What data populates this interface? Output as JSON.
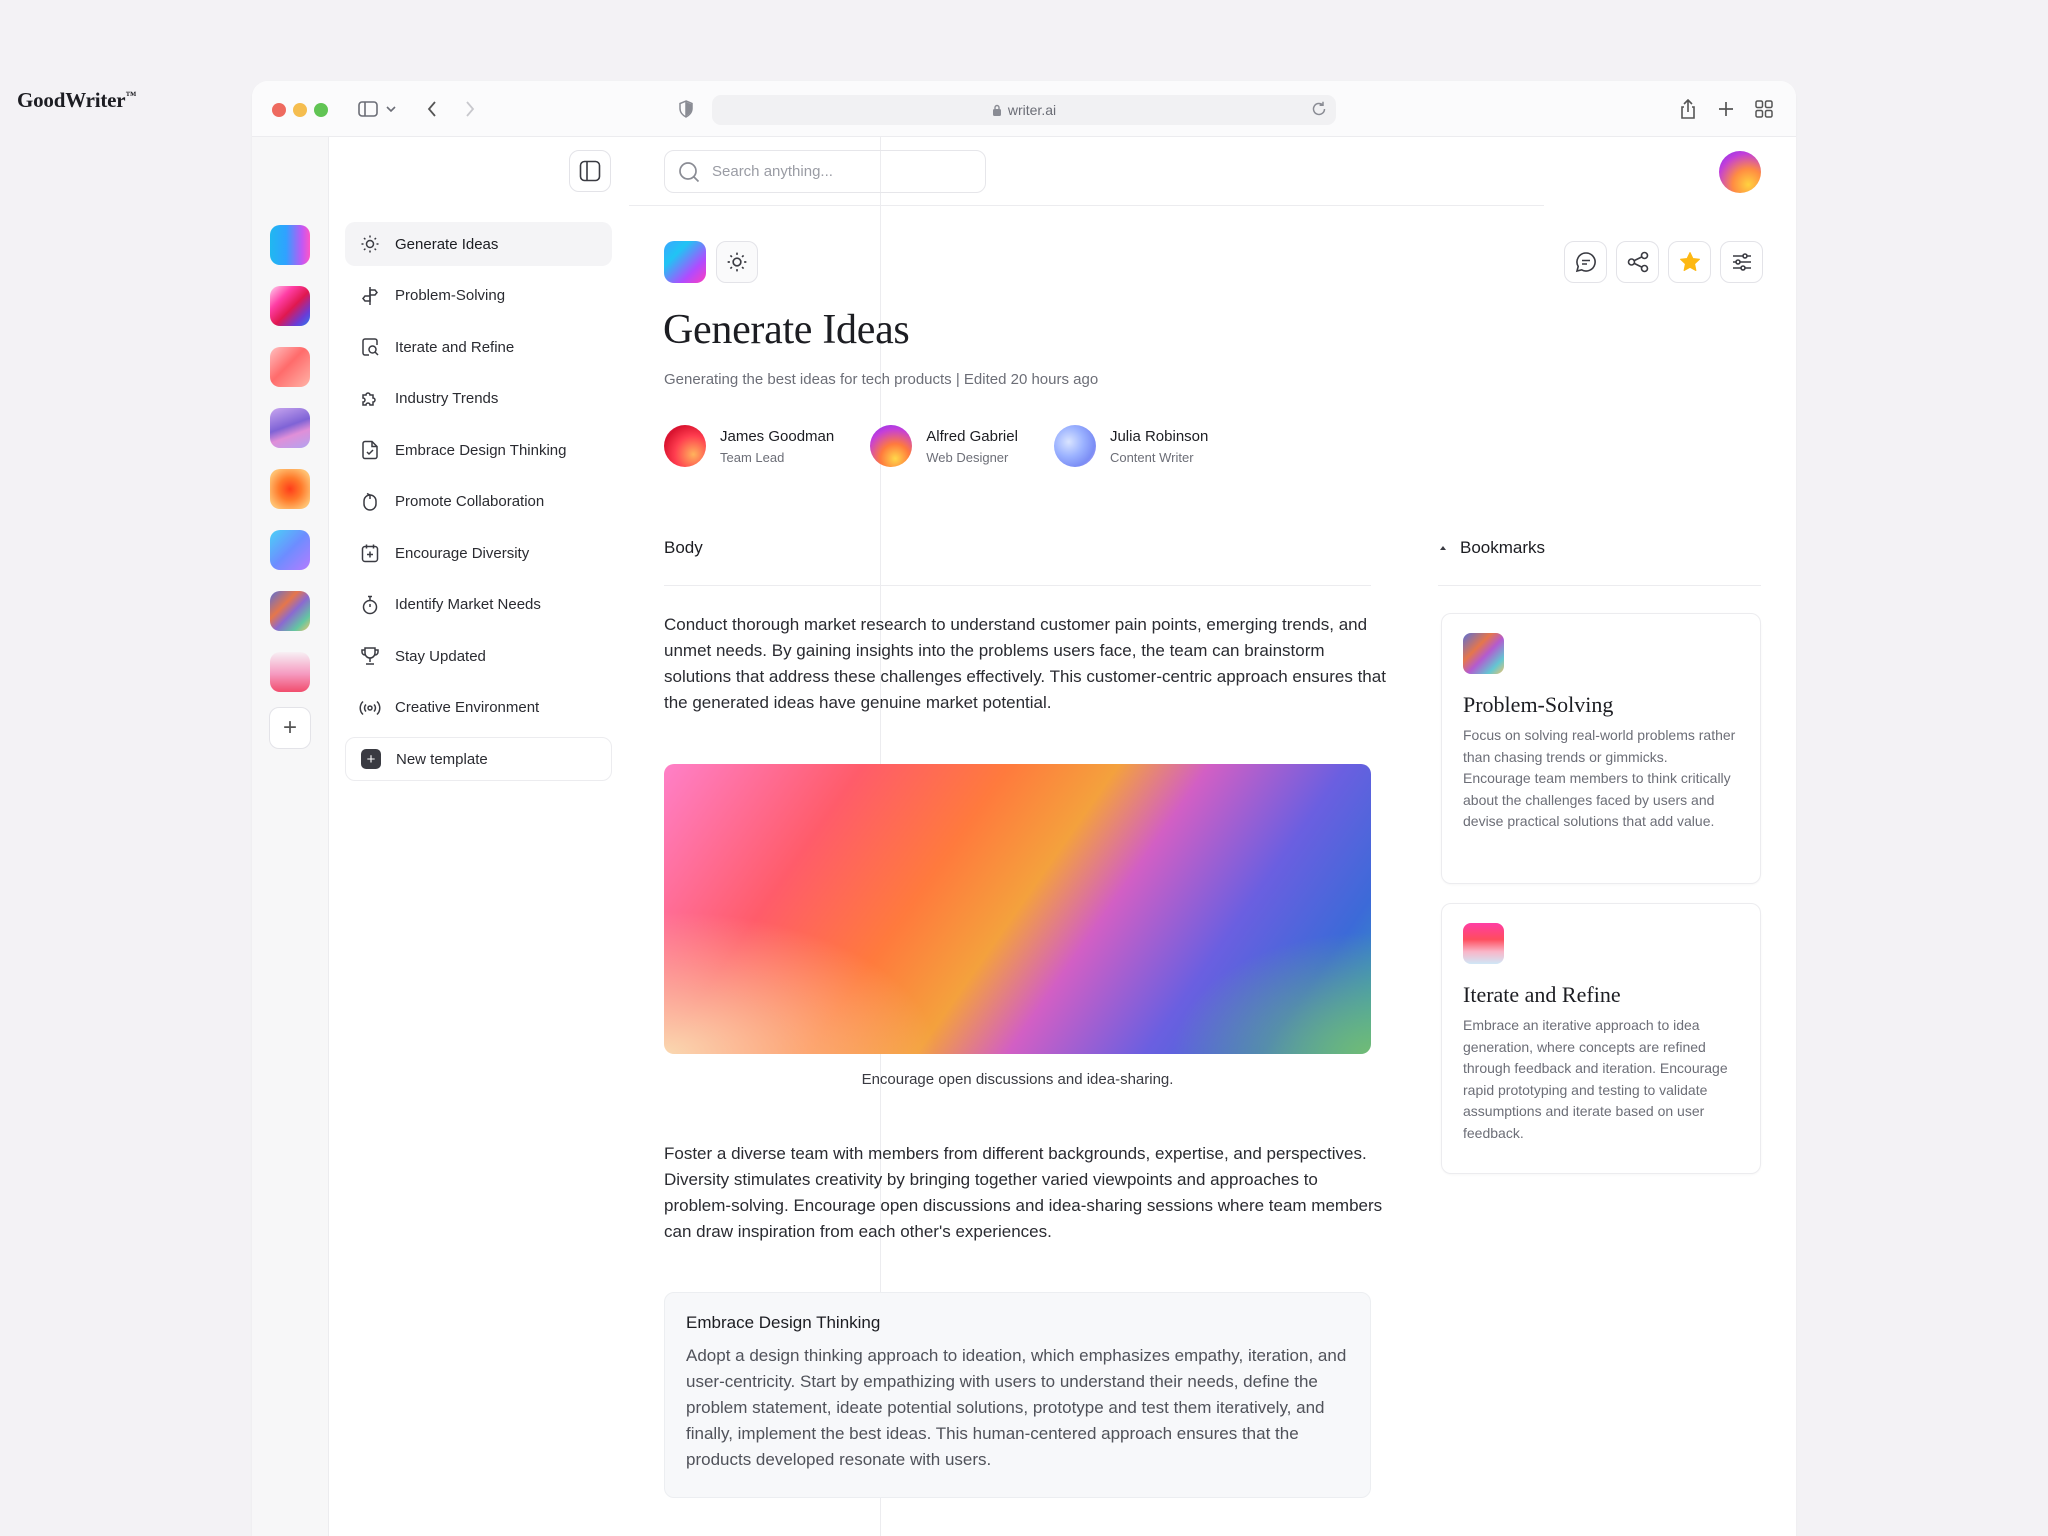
{
  "browser": {
    "url": "writer.ai"
  },
  "app": {
    "brand": "GoodWriter",
    "brand_mark": "™"
  },
  "search": {
    "placeholder": "Search anything..."
  },
  "sidebar": {
    "items": [
      {
        "label": "Generate Ideas",
        "icon": "sun-icon",
        "active": true
      },
      {
        "label": "Problem-Solving",
        "icon": "signpost-icon"
      },
      {
        "label": "Iterate and Refine",
        "icon": "search-document-icon"
      },
      {
        "label": "Industry Trends",
        "icon": "puzzle-icon"
      },
      {
        "label": "Embrace Design Thinking",
        "icon": "file-check-icon"
      },
      {
        "label": "Promote Collaboration",
        "icon": "mouse-icon"
      },
      {
        "label": "Encourage Diversity",
        "icon": "calendar-plus-icon"
      },
      {
        "label": "Identify Market Needs",
        "icon": "stopwatch-icon"
      },
      {
        "label": "Stay Updated",
        "icon": "trophy-icon"
      },
      {
        "label": "Creative Environment",
        "icon": "broadcast-icon"
      }
    ],
    "new_template": "New template"
  },
  "doc": {
    "title": "Generate Ideas",
    "subtitle": "Generating the best ideas for tech products | Edited 20 hours ago",
    "people": [
      {
        "name": "James Goodman",
        "role": "Team Lead"
      },
      {
        "name": "Alfred Gabriel",
        "role": "Web Designer"
      },
      {
        "name": "Julia Robinson",
        "role": "Content Writer"
      }
    ],
    "body_heading": "Body",
    "para1": "Conduct thorough market research to understand customer pain points, emerging trends, and unmet needs. By gaining insights into the problems users face, the team can brainstorm solutions that address these challenges effectively. This customer-centric approach ensures that the generated ideas have genuine market potential.",
    "caption": "Encourage open discussions and idea-sharing.",
    "para2": "Foster a diverse team with members from different backgrounds, expertise, and perspectives. Diversity stimulates creativity by bringing together varied viewpoints and approaches to problem-solving. Encourage open discussions and idea-sharing sessions where team members can draw inspiration from each other's experiences.",
    "callout": {
      "title": "Embrace Design Thinking",
      "text": "Adopt a design thinking approach to ideation, which emphasizes empathy, iteration, and user-centricity. Start by empathizing with users to understand their needs, define the problem statement, ideate potential solutions, prototype and test them iteratively, and finally, implement the best ideas. This human-centered approach ensures that the products developed resonate with users."
    }
  },
  "bookmarks": {
    "heading": "Bookmarks",
    "cards": [
      {
        "title": "Problem-Solving",
        "text": "Focus on solving real-world problems rather than chasing trends or gimmicks. Encourage team members to think critically about the challenges faced by users and devise practical solutions that add value."
      },
      {
        "title": "Iterate and Refine",
        "text": "Embrace an iterative approach to idea generation, where concepts are refined through feedback and iteration. Encourage rapid prototyping and testing to validate assumptions and iterate based on user feedback."
      }
    ]
  },
  "colors": {
    "accent_star": "#fdb813",
    "text": "#1c1d22",
    "muted": "#6c6e77"
  }
}
